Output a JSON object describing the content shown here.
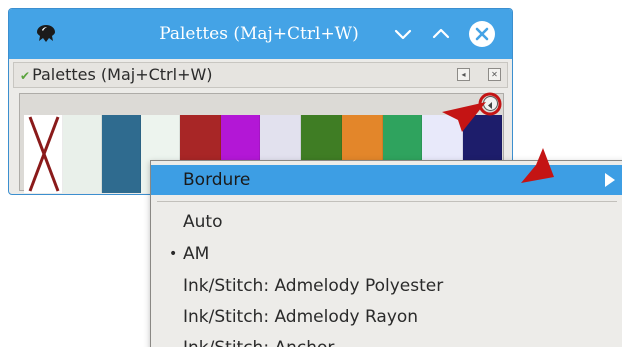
{
  "window": {
    "title": "Palettes (Maj+Ctrl+W)",
    "titlebar_color": "#44a3e6",
    "buttons": [
      "minimize-icon",
      "maximize-icon",
      "close-icon"
    ]
  },
  "dock": {
    "title": "Palettes (Maj+Ctrl+W)",
    "check_icon": "check-icon"
  },
  "palette": {
    "swatches": [
      {
        "color": "#ffffff",
        "none": true
      },
      {
        "color": "#e9f0ea"
      },
      {
        "color": "#2f6b8f"
      },
      {
        "color": "#edf4ee"
      },
      {
        "color": "#a82626"
      },
      {
        "color": "#b317d6"
      },
      {
        "color": "#e2e1ee"
      },
      {
        "color": "#3f7d24"
      },
      {
        "color": "#e3862a"
      },
      {
        "color": "#2fa35e"
      },
      {
        "color": "#e8e9fa"
      },
      {
        "color": "#1d1d6b"
      }
    ]
  },
  "menu": {
    "highlighted": "Bordure",
    "items": [
      {
        "label": "Auto",
        "selected": false
      },
      {
        "label": "AM",
        "selected": true
      },
      {
        "label": "Ink/Stitch: Admelody Polyester",
        "selected": false
      },
      {
        "label": "Ink/Stitch: Admelody Rayon",
        "selected": false
      },
      {
        "label": "Ink/Stitch: Anchor",
        "selected": false
      }
    ],
    "bullet": "•",
    "highlight_color": "#3d9ee4"
  },
  "annotation_color": "#c41414"
}
